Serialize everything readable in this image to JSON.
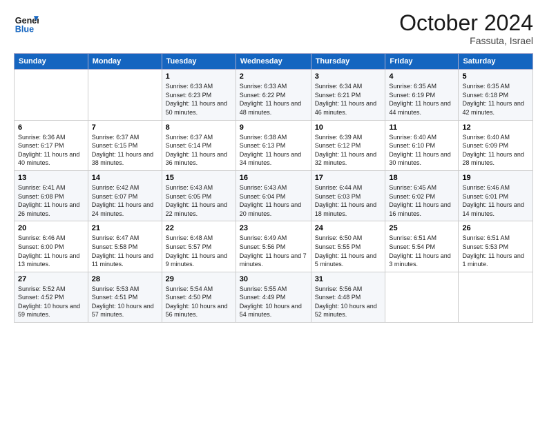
{
  "logo": {
    "line1": "General",
    "line2": "Blue"
  },
  "title": "October 2024",
  "subtitle": "Fassuta, Israel",
  "headers": [
    "Sunday",
    "Monday",
    "Tuesday",
    "Wednesday",
    "Thursday",
    "Friday",
    "Saturday"
  ],
  "weeks": [
    [
      {
        "day": "",
        "info": ""
      },
      {
        "day": "",
        "info": ""
      },
      {
        "day": "1",
        "info": "Sunrise: 6:33 AM\nSunset: 6:23 PM\nDaylight: 11 hours and 50 minutes."
      },
      {
        "day": "2",
        "info": "Sunrise: 6:33 AM\nSunset: 6:22 PM\nDaylight: 11 hours and 48 minutes."
      },
      {
        "day": "3",
        "info": "Sunrise: 6:34 AM\nSunset: 6:21 PM\nDaylight: 11 hours and 46 minutes."
      },
      {
        "day": "4",
        "info": "Sunrise: 6:35 AM\nSunset: 6:19 PM\nDaylight: 11 hours and 44 minutes."
      },
      {
        "day": "5",
        "info": "Sunrise: 6:35 AM\nSunset: 6:18 PM\nDaylight: 11 hours and 42 minutes."
      }
    ],
    [
      {
        "day": "6",
        "info": "Sunrise: 6:36 AM\nSunset: 6:17 PM\nDaylight: 11 hours and 40 minutes."
      },
      {
        "day": "7",
        "info": "Sunrise: 6:37 AM\nSunset: 6:15 PM\nDaylight: 11 hours and 38 minutes."
      },
      {
        "day": "8",
        "info": "Sunrise: 6:37 AM\nSunset: 6:14 PM\nDaylight: 11 hours and 36 minutes."
      },
      {
        "day": "9",
        "info": "Sunrise: 6:38 AM\nSunset: 6:13 PM\nDaylight: 11 hours and 34 minutes."
      },
      {
        "day": "10",
        "info": "Sunrise: 6:39 AM\nSunset: 6:12 PM\nDaylight: 11 hours and 32 minutes."
      },
      {
        "day": "11",
        "info": "Sunrise: 6:40 AM\nSunset: 6:10 PM\nDaylight: 11 hours and 30 minutes."
      },
      {
        "day": "12",
        "info": "Sunrise: 6:40 AM\nSunset: 6:09 PM\nDaylight: 11 hours and 28 minutes."
      }
    ],
    [
      {
        "day": "13",
        "info": "Sunrise: 6:41 AM\nSunset: 6:08 PM\nDaylight: 11 hours and 26 minutes."
      },
      {
        "day": "14",
        "info": "Sunrise: 6:42 AM\nSunset: 6:07 PM\nDaylight: 11 hours and 24 minutes."
      },
      {
        "day": "15",
        "info": "Sunrise: 6:43 AM\nSunset: 6:05 PM\nDaylight: 11 hours and 22 minutes."
      },
      {
        "day": "16",
        "info": "Sunrise: 6:43 AM\nSunset: 6:04 PM\nDaylight: 11 hours and 20 minutes."
      },
      {
        "day": "17",
        "info": "Sunrise: 6:44 AM\nSunset: 6:03 PM\nDaylight: 11 hours and 18 minutes."
      },
      {
        "day": "18",
        "info": "Sunrise: 6:45 AM\nSunset: 6:02 PM\nDaylight: 11 hours and 16 minutes."
      },
      {
        "day": "19",
        "info": "Sunrise: 6:46 AM\nSunset: 6:01 PM\nDaylight: 11 hours and 14 minutes."
      }
    ],
    [
      {
        "day": "20",
        "info": "Sunrise: 6:46 AM\nSunset: 6:00 PM\nDaylight: 11 hours and 13 minutes."
      },
      {
        "day": "21",
        "info": "Sunrise: 6:47 AM\nSunset: 5:58 PM\nDaylight: 11 hours and 11 minutes."
      },
      {
        "day": "22",
        "info": "Sunrise: 6:48 AM\nSunset: 5:57 PM\nDaylight: 11 hours and 9 minutes."
      },
      {
        "day": "23",
        "info": "Sunrise: 6:49 AM\nSunset: 5:56 PM\nDaylight: 11 hours and 7 minutes."
      },
      {
        "day": "24",
        "info": "Sunrise: 6:50 AM\nSunset: 5:55 PM\nDaylight: 11 hours and 5 minutes."
      },
      {
        "day": "25",
        "info": "Sunrise: 6:51 AM\nSunset: 5:54 PM\nDaylight: 11 hours and 3 minutes."
      },
      {
        "day": "26",
        "info": "Sunrise: 6:51 AM\nSunset: 5:53 PM\nDaylight: 11 hours and 1 minute."
      }
    ],
    [
      {
        "day": "27",
        "info": "Sunrise: 5:52 AM\nSunset: 4:52 PM\nDaylight: 10 hours and 59 minutes."
      },
      {
        "day": "28",
        "info": "Sunrise: 5:53 AM\nSunset: 4:51 PM\nDaylight: 10 hours and 57 minutes."
      },
      {
        "day": "29",
        "info": "Sunrise: 5:54 AM\nSunset: 4:50 PM\nDaylight: 10 hours and 56 minutes."
      },
      {
        "day": "30",
        "info": "Sunrise: 5:55 AM\nSunset: 4:49 PM\nDaylight: 10 hours and 54 minutes."
      },
      {
        "day": "31",
        "info": "Sunrise: 5:56 AM\nSunset: 4:48 PM\nDaylight: 10 hours and 52 minutes."
      },
      {
        "day": "",
        "info": ""
      },
      {
        "day": "",
        "info": ""
      }
    ]
  ]
}
